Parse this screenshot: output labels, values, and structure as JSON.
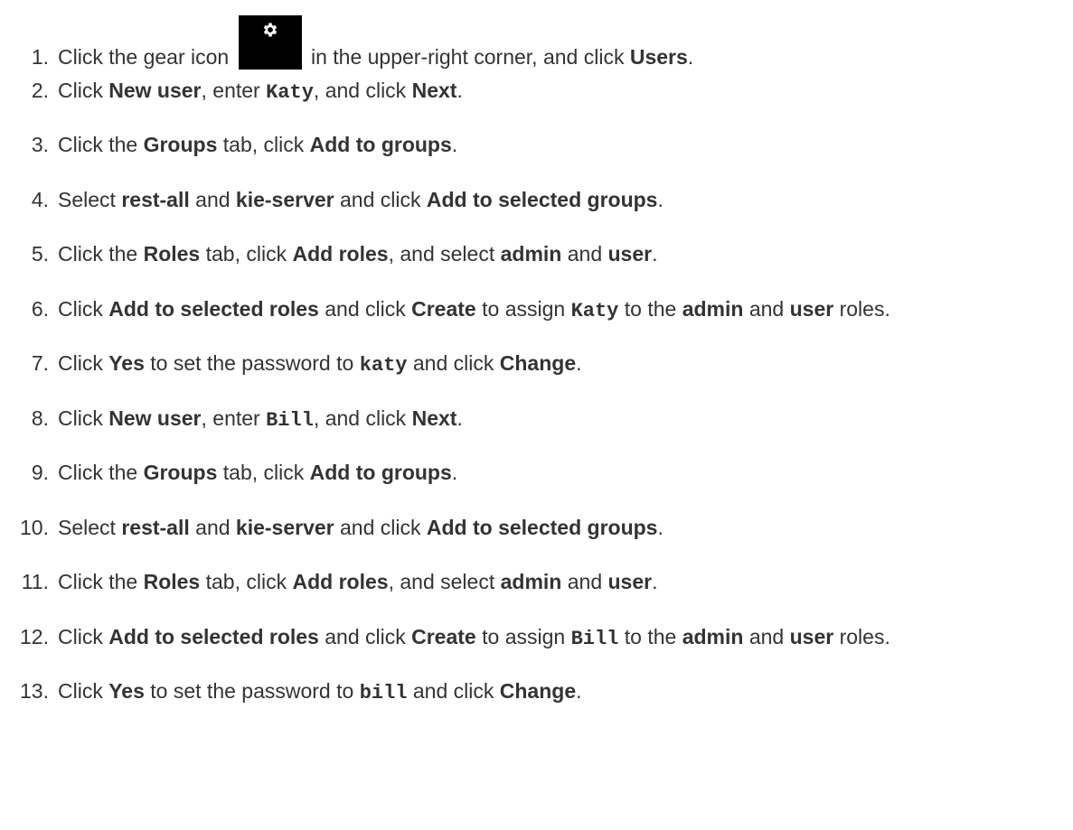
{
  "steps": [
    {
      "num": "1.",
      "parts": [
        {
          "t": "Click the gear icon "
        },
        {
          "icon": "gear-icon"
        },
        {
          "t": " in the upper-right corner, and click "
        },
        {
          "t": "Users",
          "s": "b"
        },
        {
          "t": "."
        }
      ]
    },
    {
      "num": "2.",
      "parts": [
        {
          "t": "Click "
        },
        {
          "t": "New user",
          "s": "b"
        },
        {
          "t": ", enter "
        },
        {
          "t": "Katy",
          "s": "code"
        },
        {
          "t": ", and click "
        },
        {
          "t": "Next",
          "s": "b"
        },
        {
          "t": "."
        }
      ]
    },
    {
      "num": "3.",
      "parts": [
        {
          "t": "Click the "
        },
        {
          "t": "Groups",
          "s": "b"
        },
        {
          "t": " tab, click "
        },
        {
          "t": "Add to groups",
          "s": "b"
        },
        {
          "t": "."
        }
      ]
    },
    {
      "num": "4.",
      "parts": [
        {
          "t": "Select "
        },
        {
          "t": "rest-all",
          "s": "b"
        },
        {
          "t": " and "
        },
        {
          "t": "kie-server",
          "s": "b"
        },
        {
          "t": " and click "
        },
        {
          "t": "Add to selected groups",
          "s": "b"
        },
        {
          "t": "."
        }
      ]
    },
    {
      "num": "5.",
      "parts": [
        {
          "t": "Click the "
        },
        {
          "t": "Roles",
          "s": "b"
        },
        {
          "t": " tab, click "
        },
        {
          "t": "Add roles",
          "s": "b"
        },
        {
          "t": ", and select "
        },
        {
          "t": "admin",
          "s": "b"
        },
        {
          "t": " and "
        },
        {
          "t": "user",
          "s": "b"
        },
        {
          "t": "."
        }
      ]
    },
    {
      "num": "6.",
      "parts": [
        {
          "t": "Click "
        },
        {
          "t": "Add to selected roles",
          "s": "b"
        },
        {
          "t": " and click "
        },
        {
          "t": "Create",
          "s": "b"
        },
        {
          "t": " to assign "
        },
        {
          "t": "Katy",
          "s": "code"
        },
        {
          "t": " to the "
        },
        {
          "t": "admin",
          "s": "b"
        },
        {
          "t": " and "
        },
        {
          "t": "user",
          "s": "b"
        },
        {
          "t": " roles."
        }
      ]
    },
    {
      "num": "7.",
      "parts": [
        {
          "t": "Click "
        },
        {
          "t": "Yes",
          "s": "b"
        },
        {
          "t": " to set the password to "
        },
        {
          "t": "katy",
          "s": "code"
        },
        {
          "t": " and click "
        },
        {
          "t": "Change",
          "s": "b"
        },
        {
          "t": "."
        }
      ]
    },
    {
      "num": "8.",
      "parts": [
        {
          "t": "Click "
        },
        {
          "t": "New user",
          "s": "b"
        },
        {
          "t": ", enter "
        },
        {
          "t": "Bill",
          "s": "code"
        },
        {
          "t": ", and click "
        },
        {
          "t": "Next",
          "s": "b"
        },
        {
          "t": "."
        }
      ]
    },
    {
      "num": "9.",
      "parts": [
        {
          "t": "Click the "
        },
        {
          "t": "Groups",
          "s": "b"
        },
        {
          "t": " tab, click "
        },
        {
          "t": "Add to groups",
          "s": "b"
        },
        {
          "t": "."
        }
      ]
    },
    {
      "num": "10.",
      "parts": [
        {
          "t": "Select "
        },
        {
          "t": "rest-all",
          "s": "b"
        },
        {
          "t": " and "
        },
        {
          "t": "kie-server",
          "s": "b"
        },
        {
          "t": " and click "
        },
        {
          "t": "Add to selected groups",
          "s": "b"
        },
        {
          "t": "."
        }
      ]
    },
    {
      "num": "11.",
      "parts": [
        {
          "t": "Click the "
        },
        {
          "t": "Roles",
          "s": "b"
        },
        {
          "t": " tab, click "
        },
        {
          "t": "Add roles",
          "s": "b"
        },
        {
          "t": ", and select "
        },
        {
          "t": "admin",
          "s": "b"
        },
        {
          "t": " and "
        },
        {
          "t": "user",
          "s": "b"
        },
        {
          "t": "."
        }
      ]
    },
    {
      "num": "12.",
      "parts": [
        {
          "t": "Click "
        },
        {
          "t": "Add to selected roles",
          "s": "b"
        },
        {
          "t": " and click "
        },
        {
          "t": "Create",
          "s": "b"
        },
        {
          "t": " to assign "
        },
        {
          "t": "Bill",
          "s": "code"
        },
        {
          "t": " to the "
        },
        {
          "t": "admin",
          "s": "b"
        },
        {
          "t": " and "
        },
        {
          "t": "user",
          "s": "b"
        },
        {
          "t": " roles."
        }
      ]
    },
    {
      "num": "13.",
      "parts": [
        {
          "t": "Click "
        },
        {
          "t": "Yes",
          "s": "b"
        },
        {
          "t": " to set the password to "
        },
        {
          "t": "bill",
          "s": "code"
        },
        {
          "t": " and click "
        },
        {
          "t": "Change",
          "s": "b"
        },
        {
          "t": "."
        }
      ]
    }
  ]
}
